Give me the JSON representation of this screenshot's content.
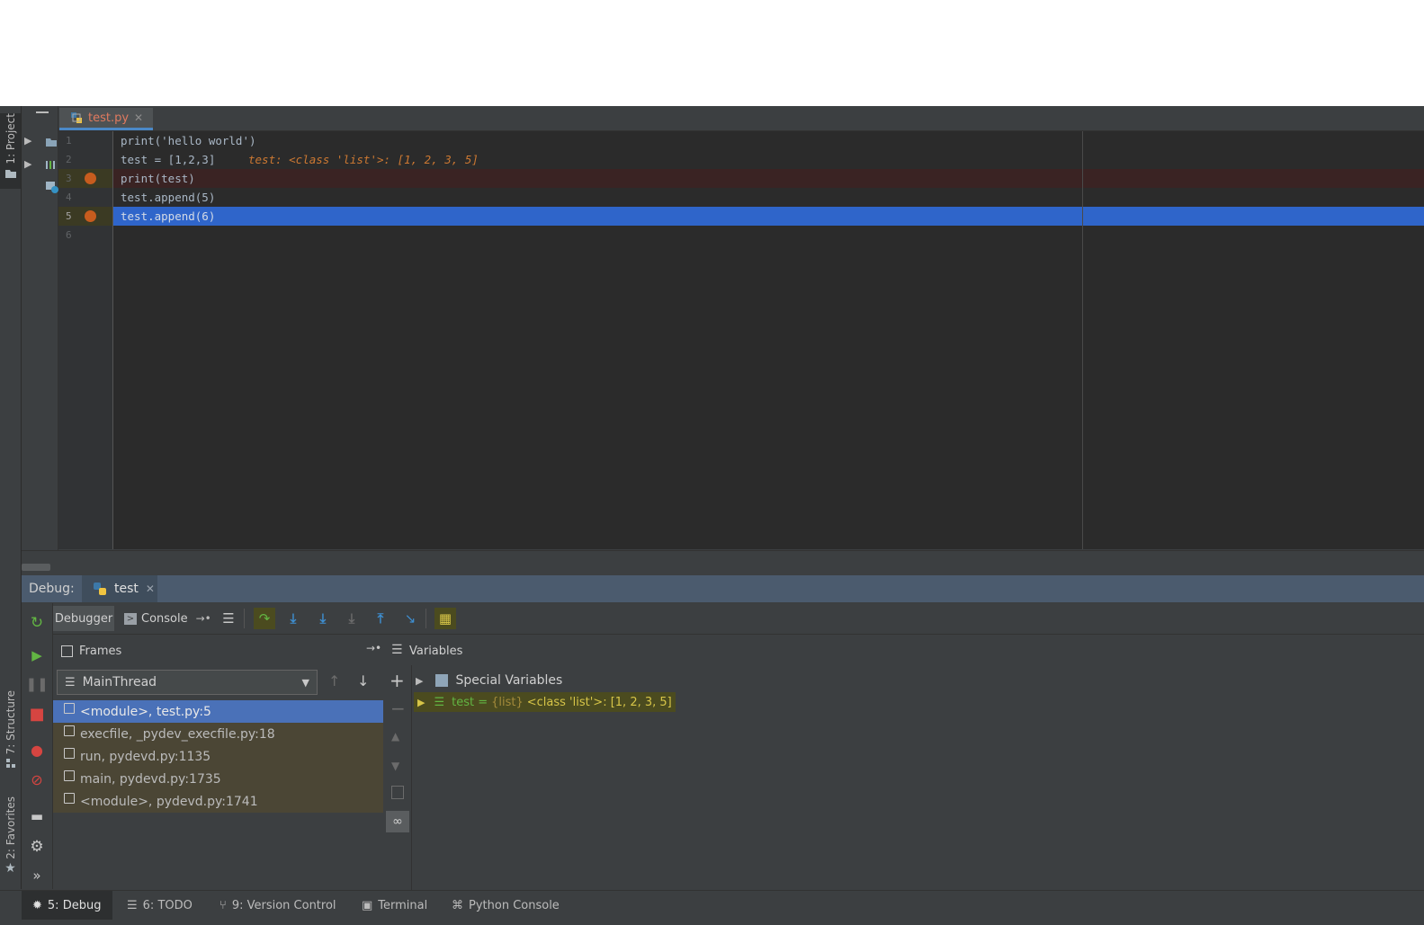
{
  "sidebar_left": {
    "project_tab": "1: Project",
    "structure_tab": "7: Structure",
    "favorites_tab": "2: Favorites"
  },
  "editor": {
    "tab_filename": "test.py",
    "lines": [
      {
        "num": "1",
        "text": "print('hello world')",
        "breakpoint": false
      },
      {
        "num": "2",
        "text": "test = [1,2,3]",
        "inline_hint": "test: <class 'list'>: [1, 2, 3, 5]",
        "breakpoint": false
      },
      {
        "num": "3",
        "text": "print(test)",
        "breakpoint": true
      },
      {
        "num": "4",
        "text": "test.append(5)",
        "breakpoint": false
      },
      {
        "num": "5",
        "text": "test.append(6)",
        "breakpoint": true,
        "current": true
      },
      {
        "num": "6",
        "text": "",
        "breakpoint": false
      }
    ]
  },
  "debug": {
    "label": "Debug:",
    "session_tab": "test",
    "tab_debugger": "Debugger",
    "tab_console": "Console",
    "frames_title": "Frames",
    "variables_title": "Variables",
    "thread": "MainThread",
    "frames": [
      "<module>, test.py:5",
      "execfile, _pydev_execfile.py:18",
      "run, pydevd.py:1135",
      "main, pydevd.py:1735",
      "<module>, pydevd.py:1741"
    ],
    "variables": {
      "special": "Special Variables",
      "test_name": "test = ",
      "test_type": "{list} ",
      "test_value": "<class 'list'>: [1, 2, 3, 5]"
    }
  },
  "statusbar": {
    "debug": "5: Debug",
    "todo": "6: TODO",
    "vcs": "9: Version Control",
    "terminal": "Terminal",
    "python_console": "Python Console"
  },
  "colors": {
    "accent": "#4a88c7",
    "breakpoint": "#c75c1e",
    "current_line": "#2f65ca"
  }
}
